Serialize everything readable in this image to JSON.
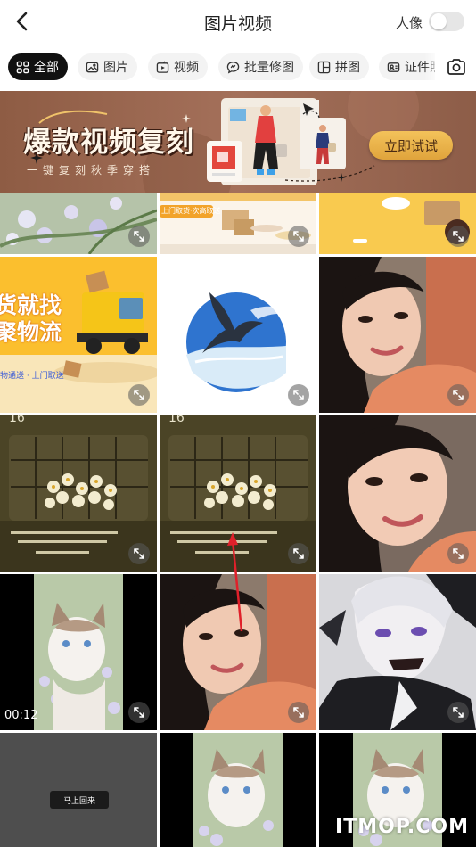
{
  "header": {
    "title": "图片视频",
    "portrait_label": "人像",
    "portrait_toggle_on": false
  },
  "chips": [
    {
      "label": "全部",
      "icon": "grid-icon",
      "active": true
    },
    {
      "label": "图片",
      "icon": "image-icon",
      "active": false
    },
    {
      "label": "视频",
      "icon": "video-icon",
      "active": false
    },
    {
      "label": "批量修图",
      "icon": "batch-edit-icon",
      "active": false
    },
    {
      "label": "拼图",
      "icon": "collage-icon",
      "active": false
    },
    {
      "label": "证件照",
      "icon": "id-photo-icon",
      "active": false
    }
  ],
  "banner": {
    "headline": "爆款视频复刻",
    "subline": "一键复刻秋季穿搭",
    "cta": "立即试试",
    "colors": {
      "background": "#9b6a55",
      "cta": "#e9b24a"
    }
  },
  "grid": {
    "cells": [
      {
        "kind": "image",
        "subject": "purple flowers"
      },
      {
        "kind": "image",
        "subject": "delivery promo",
        "caption": "上门取货·次高取送"
      },
      {
        "kind": "image",
        "subject": "yellow promo with box"
      },
      {
        "kind": "image",
        "subject": "logistics truck ad",
        "text_lines": [
          "货就找",
          "聚物流"
        ],
        "caption": "物通送 · 上门取送"
      },
      {
        "kind": "image",
        "subject": "bird over sea circle"
      },
      {
        "kind": "image",
        "subject": "portrait woman"
      },
      {
        "kind": "image",
        "subject": "daisies wallpaper",
        "date_text": "16"
      },
      {
        "kind": "image",
        "subject": "daisies wallpaper",
        "date_text": "16"
      },
      {
        "kind": "image",
        "subject": "portrait woman close"
      },
      {
        "kind": "video",
        "subject": "kitten in flowers",
        "duration": "00:12"
      },
      {
        "kind": "image",
        "subject": "portrait woman"
      },
      {
        "kind": "image",
        "subject": "anime character"
      },
      {
        "kind": "image",
        "subject": "dark placeholder",
        "button_label": "马上回来"
      },
      {
        "kind": "image",
        "subject": "kitten in flowers"
      },
      {
        "kind": "image",
        "subject": "kitten in flowers"
      }
    ]
  },
  "watermark": "ITMOP.COM"
}
